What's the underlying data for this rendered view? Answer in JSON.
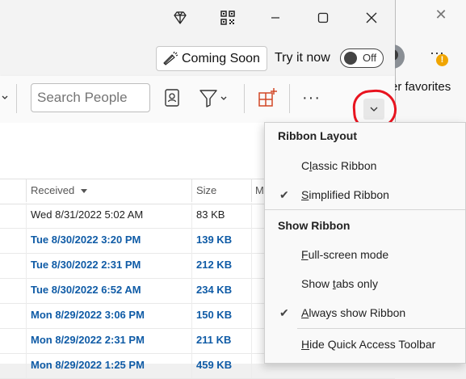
{
  "titlebar": {
    "icons": [
      "diamond-icon",
      "qr-code-icon",
      "minimize-icon",
      "maximize-icon",
      "close-icon"
    ]
  },
  "side_window": {
    "close_glyph": "✕",
    "favorites_label": "er favorites"
  },
  "coming_soon": {
    "label": "Coming Soon",
    "try_label": "Try it now",
    "toggle_text": "Off"
  },
  "ribbon": {
    "search_placeholder": "Search People",
    "icons": [
      "address-book-icon",
      "filter-icon",
      "new-group-icon",
      "more-icon",
      "collapse-ribbon-icon"
    ],
    "more_glyph": "···"
  },
  "maillist": {
    "columns": [
      "Received",
      "Size",
      "M"
    ],
    "rows": [
      {
        "received": "Wed 8/31/2022 5:02 AM",
        "size": "83 KB",
        "unread": false
      },
      {
        "received": "Tue 8/30/2022 3:20 PM",
        "size": "139 KB",
        "unread": true
      },
      {
        "received": "Tue 8/30/2022 2:31 PM",
        "size": "212 KB",
        "unread": true
      },
      {
        "received": "Tue 8/30/2022 6:52 AM",
        "size": "234 KB",
        "unread": true
      },
      {
        "received": "Mon 8/29/2022 3:06 PM",
        "size": "150 KB",
        "unread": true
      },
      {
        "received": "Mon 8/29/2022 2:31 PM",
        "size": "211 KB",
        "unread": true
      },
      {
        "received": "Mon 8/29/2022 1:25 PM",
        "size": "459 KB",
        "unread": true
      }
    ]
  },
  "ribbon_menu": {
    "layout_heading": "Ribbon Layout",
    "classic_pre": "C",
    "classic_key": "l",
    "classic_post": "assic Ribbon",
    "simplified_key": "S",
    "simplified_post": "implified Ribbon",
    "show_heading": "Show Ribbon",
    "fullscreen_key": "F",
    "fullscreen_post": "ull-screen mode",
    "tabs_pre": "Show ",
    "tabs_key": "t",
    "tabs_post": "abs only",
    "always_key": "A",
    "always_post": "lways show Ribbon",
    "hide_key": "H",
    "hide_post": "ide Quick Access Toolbar",
    "check_glyph": "✔"
  },
  "colors": {
    "unread_text": "#0f5ba6",
    "highlight_ring": "#e8141f",
    "notification_badge": "#f0a500"
  }
}
